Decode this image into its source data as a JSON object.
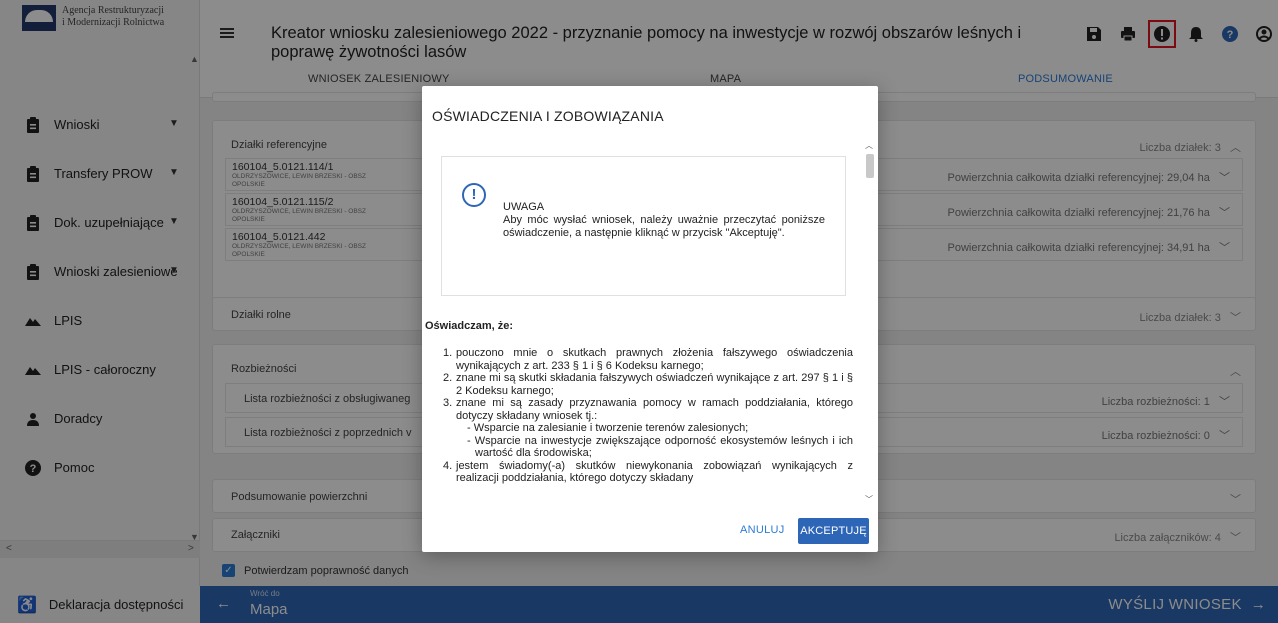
{
  "brand": {
    "line1": "Agencja Restrukturyzacji",
    "line2": "i Modernizacji Rolnictwa"
  },
  "sidebar": {
    "items": [
      {
        "label": "Wnioski",
        "icon": "clipboard-icon",
        "chevron": true
      },
      {
        "label": "Transfery PROW",
        "icon": "clipboard-icon",
        "chevron": true
      },
      {
        "label": "Dok. uzupełniające",
        "icon": "clipboard-icon",
        "chevron": true
      },
      {
        "label": "Wnioski zalesieniowe",
        "icon": "clipboard-icon",
        "chevron": true
      },
      {
        "label": "LPIS",
        "icon": "terrain-icon",
        "chevron": false
      },
      {
        "label": "LPIS - całoroczny",
        "icon": "terrain-icon",
        "chevron": false
      },
      {
        "label": "Doradcy",
        "icon": "person-icon",
        "chevron": false
      },
      {
        "label": "Pomoc",
        "icon": "help-icon",
        "chevron": false
      }
    ],
    "accessibility": "Deklaracja dostępności"
  },
  "header": {
    "title": "Kreator wniosku zalesieniowego 2022 - przyznanie pomocy na inwestycje w rozwój obszarów leśnych i poprawę żywotności lasów",
    "icons": [
      "save-icon",
      "print-icon",
      "alert-icon",
      "bell-icon",
      "help-icon",
      "account-icon"
    ],
    "alert_highlight_color": "#e0141e"
  },
  "tabs": [
    {
      "label": "WNIOSEK ZALESIENIOWY",
      "active": false
    },
    {
      "label": "MAPA",
      "active": false
    },
    {
      "label": "PODSUMOWANIE",
      "active": true
    }
  ],
  "sections": {
    "dzialki_ref": {
      "title": "Działki referencyjne",
      "count": "Liczba działek: 3",
      "rows": [
        {
          "name": "160104_5.0121.114/1",
          "addr": "OLDRZYSZOWICE, LEWIN BRZESKI - OBSZ",
          "region": "OPOLSKIE",
          "area": "Powierzchnia całkowita działki referencyjnej: 29,04 ha"
        },
        {
          "name": "160104_5.0121.115/2",
          "addr": "OLDRZYSZOWICE, LEWIN BRZESKI - OBSZ",
          "region": "OPOLSKIE",
          "area": "Powierzchnia całkowita działki referencyjnej: 21,76 ha"
        },
        {
          "name": "160104_5.0121.442",
          "addr": "OLDRZYSZOWICE, LEWIN BRZESKI - OBSZ",
          "region": "OPOLSKIE",
          "area": "Powierzchnia całkowita działki referencyjnej: 34,91 ha"
        }
      ]
    },
    "dzialki_rolne": {
      "title": "Działki rolne",
      "count": "Liczba działek: 3"
    },
    "rozbieznosci": {
      "title": "Rozbieżności",
      "rows": [
        {
          "label": "Lista rozbieżności z obsługiwaneg",
          "count": "Liczba rozbieżności: 1"
        },
        {
          "label": "Lista rozbieżności z poprzednich v",
          "count": "Liczba rozbieżności: 0"
        }
      ]
    },
    "podsumowanie": {
      "title": "Podsumowanie powierzchni"
    },
    "zalaczniki": {
      "title": "Załączniki",
      "count": "Liczba załączników: 4"
    }
  },
  "footer": {
    "confirm_label": "Potwierdzam poprawność danych",
    "back_small": "Wróć do",
    "back_big": "Mapa",
    "send": "WYŚLIJ WNIOSEK"
  },
  "modal": {
    "title": "OŚWIADCZENIA I ZOBOWIĄZANIA",
    "warning_title": "UWAGA",
    "warning_text": "Aby móc wysłać wniosek, należy uważnie przeczytać poniższe oświadczenie, a następnie kliknąć w przycisk \"Akceptuję\".",
    "declare_head": "Oświadczam, że:",
    "items": [
      {
        "num": "1.",
        "text": "pouczono mnie o skutkach prawnych złożenia fałszywego oświadczenia wynikających z art. 233 § 1 i § 6 Kodeksu karnego;"
      },
      {
        "num": "2.",
        "text": "znane mi są skutki składania fałszywych oświadczeń wynikające z art. 297 § 1 i § 2 Kodeksu karnego;"
      },
      {
        "num": "3.",
        "text": "znane mi są zasady przyznawania pomocy w ramach poddziałania, którego dotyczy składany wniosek tj.:"
      },
      {
        "num": "4.",
        "text": "jestem świadomy(-a) skutków niewykonania zobowiązań wynikających z realizacji poddziałania, którego dotyczy składany"
      }
    ],
    "subitems": [
      "- Wsparcie na zalesianie i tworzenie terenów zalesionych;",
      "- Wsparcie na inwestycje zwiększające odporność ekosystemów leśnych i ich wartość dla środowiska;"
    ],
    "cancel_label": "ANULUJ",
    "accept_label": "AKCEPTUJĘ"
  }
}
